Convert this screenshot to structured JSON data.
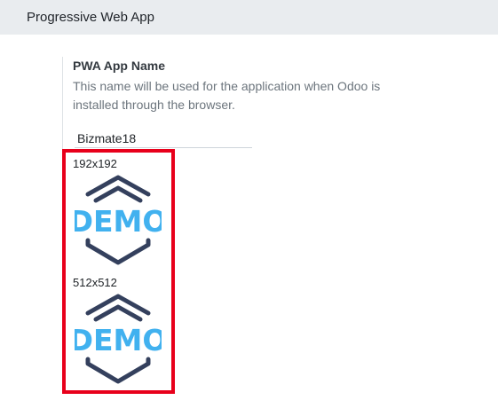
{
  "section": {
    "title": "Progressive Web App"
  },
  "pwa_name": {
    "title": "PWA App Name",
    "description": "This name will be used for the application when Odoo is installed through the browser.",
    "value": "Bizmate18"
  },
  "icons": [
    {
      "size_label": "192x192",
      "text": "DEMO"
    },
    {
      "size_label": "512x512",
      "text": "DEMO"
    }
  ],
  "colors": {
    "highlight": "#e8001b",
    "logo_dark": "#34405d",
    "logo_light": "#41b1ef"
  }
}
